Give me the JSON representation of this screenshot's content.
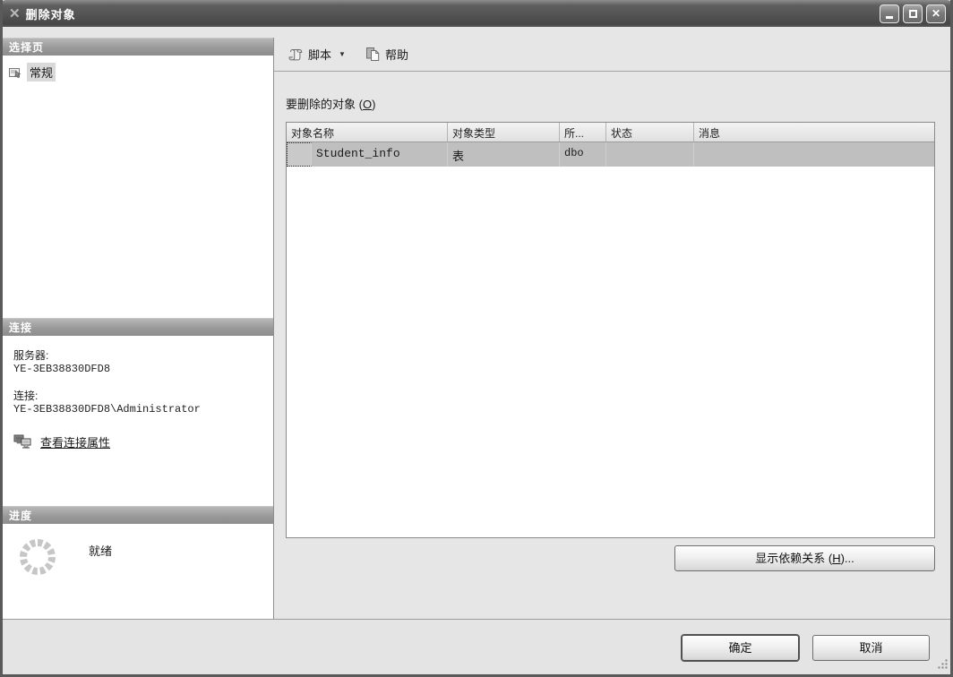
{
  "colors": {
    "frame": "#5a5a5a",
    "panel_bg": "#e6e6e6",
    "selected_row": "#bfbfbf",
    "section_header": "#999999"
  },
  "window": {
    "title": "删除对象",
    "close_glyph": "✕"
  },
  "sidebar": {
    "select_page_header": "选择页",
    "general_item": "常规",
    "connection_header": "连接",
    "server_label": "服务器:",
    "server_value": "YE-3EB38830DFD8",
    "connection_label": "连接:",
    "connection_value": "YE-3EB38830DFD8\\Administrator",
    "view_connection_link": "查看连接属性",
    "progress_header": "进度",
    "progress_status": "就绪"
  },
  "toolbar": {
    "script_label": "脚本",
    "dropdown_glyph": "▼",
    "help_label": "帮助"
  },
  "content": {
    "objects_label": {
      "prefix": "要删除的对象 (",
      "key": "O",
      "suffix": ")"
    },
    "table": {
      "columns": [
        "对象名称",
        "对象类型",
        "所...",
        "状态",
        "消息"
      ],
      "rows": [
        {
          "name": "Student_info",
          "type": "表",
          "owner": "dbo",
          "status": "",
          "message": ""
        }
      ]
    },
    "show_dependencies_button": {
      "prefix": "显示依赖关系 (",
      "key": "H",
      "suffix": ")..."
    }
  },
  "footer": {
    "ok_label": "确定",
    "cancel_label": "取消"
  }
}
